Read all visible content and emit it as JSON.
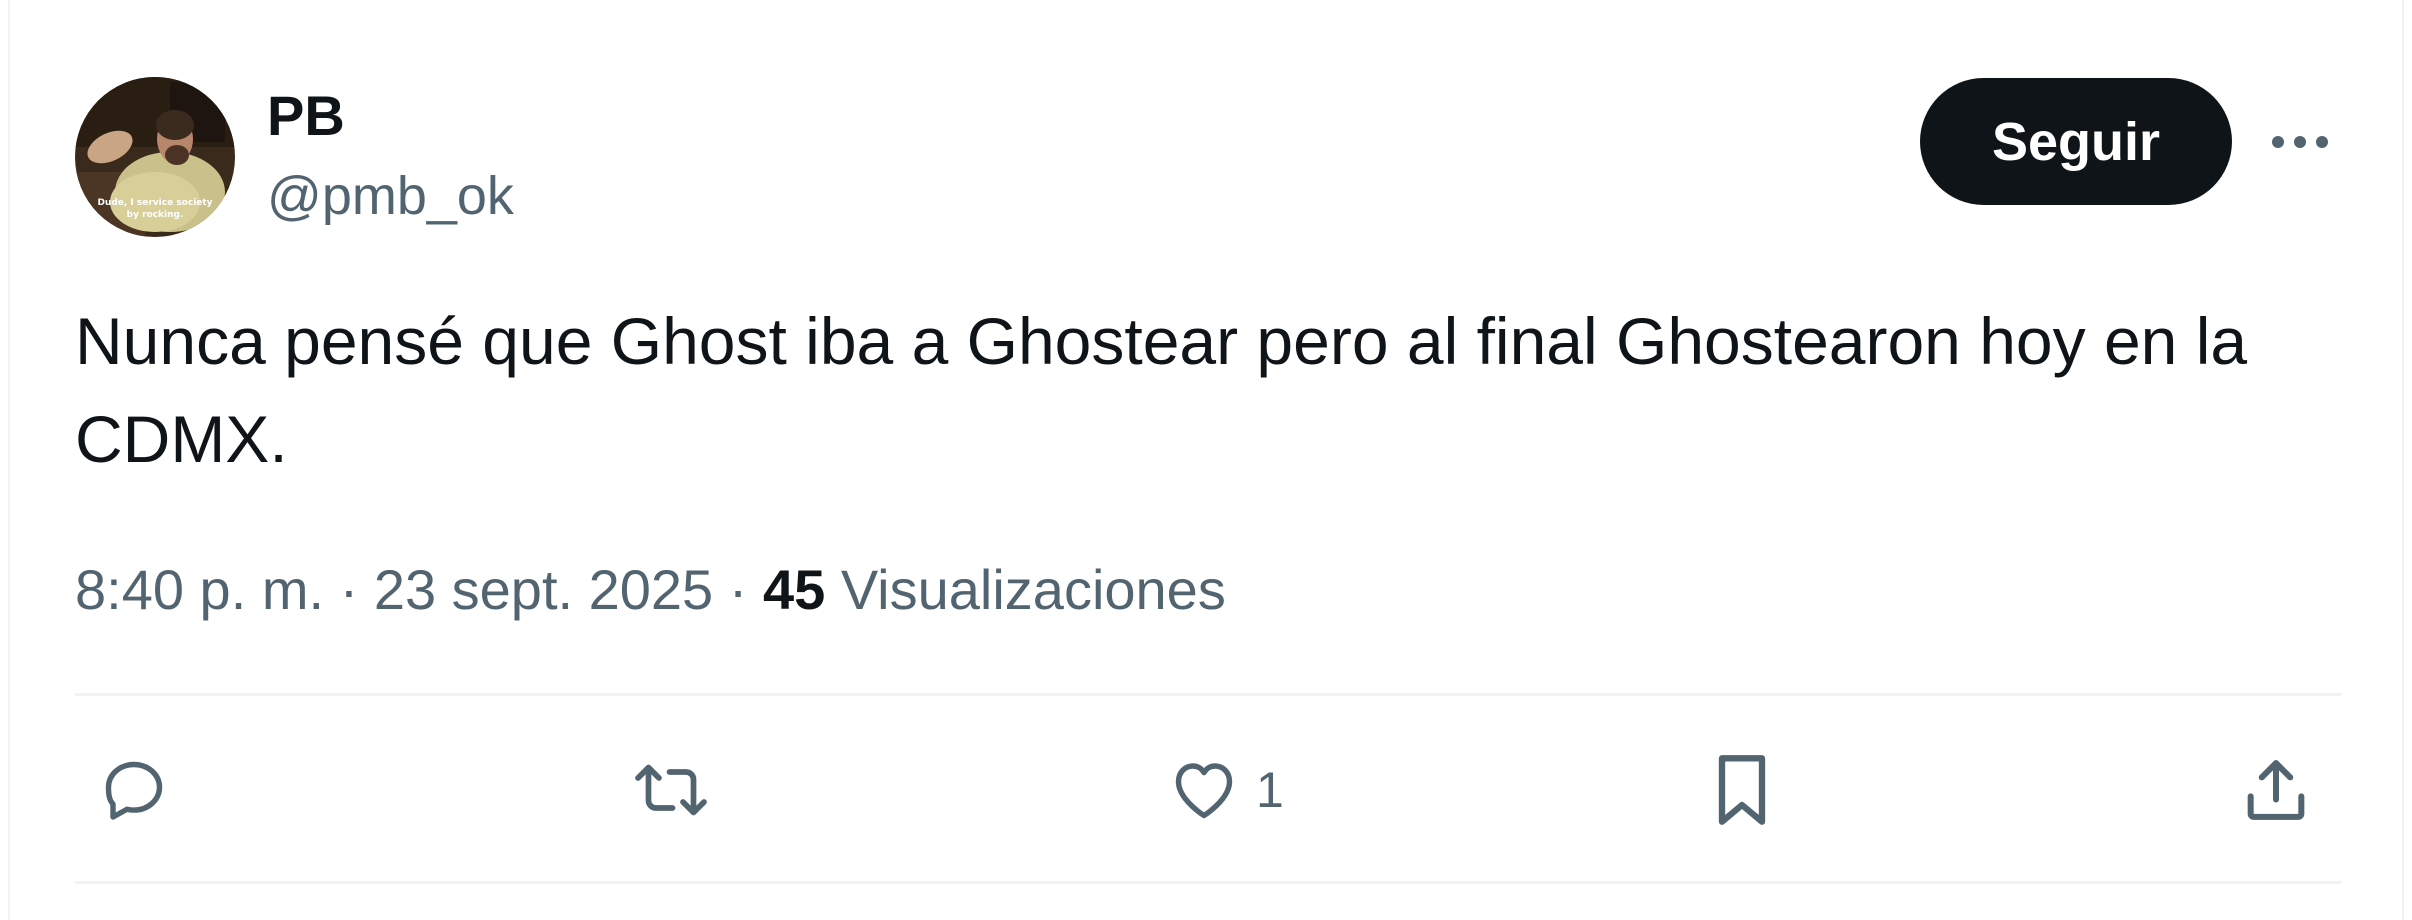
{
  "author": {
    "display_name": "PB",
    "handle": "@pmb_ok",
    "avatar_caption": "Dude, I service society by rocking."
  },
  "follow_button": {
    "label": "Seguir"
  },
  "more_button": {
    "icon": "more-horizontal-icon"
  },
  "tweet": {
    "text": "Nunca pensé que Ghost iba a Ghostear pero al final Ghostearon hoy en la CDMX.",
    "time": "8:40 p. m.",
    "separator": "·",
    "date": "23 sept. 2025",
    "views_count": "45",
    "views_label": "Visualizaciones"
  },
  "actions": {
    "reply": {
      "icon": "reply-icon"
    },
    "retweet": {
      "icon": "retweet-icon"
    },
    "like": {
      "icon": "heart-icon",
      "count": "1"
    },
    "bookmark": {
      "icon": "bookmark-icon"
    },
    "share": {
      "icon": "share-icon"
    }
  },
  "colors": {
    "text_primary": "#0f1419",
    "text_secondary": "#536471",
    "divider": "#eff3f4",
    "button_bg": "#0f1419",
    "button_text": "#ffffff"
  }
}
